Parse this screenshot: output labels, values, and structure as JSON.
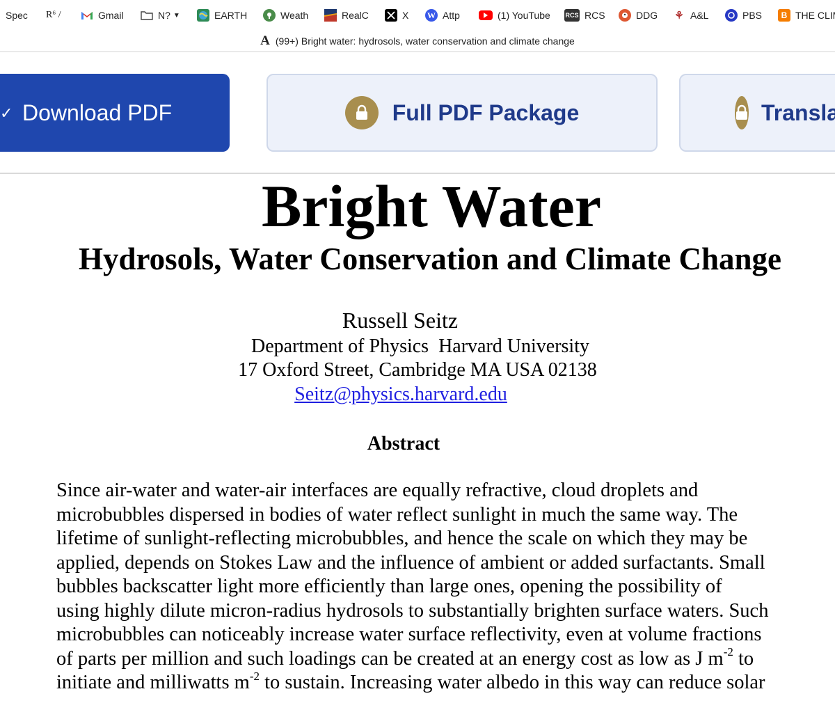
{
  "bookmarks": [
    {
      "label": "Spec",
      "icon": "none"
    },
    {
      "label": "R⁶ /",
      "icon": "none"
    },
    {
      "label": "Gmail",
      "icon": "gmail-icon"
    },
    {
      "label": "N?",
      "icon": "folder-icon"
    },
    {
      "label": "EARTH",
      "icon": "earth-icon"
    },
    {
      "label": "Weath",
      "icon": "weather-icon"
    },
    {
      "label": "RealC",
      "icon": "realclimate-icon"
    },
    {
      "label": "X",
      "icon": "x-icon"
    },
    {
      "label": "Attp",
      "icon": "wordpress-icon"
    },
    {
      "label": "(1) YouTube",
      "icon": "youtube-icon"
    },
    {
      "label": "RCS",
      "icon": "rcs-icon"
    },
    {
      "label": "DDG",
      "icon": "duckduckgo-icon"
    },
    {
      "label": "A&L",
      "icon": "al-icon"
    },
    {
      "label": "PBS",
      "icon": "pbs-icon"
    },
    {
      "label": "THE CLIMATE",
      "icon": "blogger-icon"
    }
  ],
  "tab_title": "(99+) Bright water: hydrosols, water conservation and climate change",
  "buttons": {
    "download": "Download PDF",
    "full_package": "Full PDF Package",
    "translate": "Translate"
  },
  "paper": {
    "title": "Bright Water",
    "subtitle": "Hydrosols, Water Conservation and Climate Change",
    "author": "Russell Seitz",
    "affiliation": "Department of Physics  Harvard University",
    "address": "17 Oxford Street, Cambridge MA USA 02138",
    "email": "Seitz@physics.harvard.edu",
    "abstract_heading": "Abstract",
    "abstract_lines": [
      "Since air-water and water-air interfaces are equally refractive, cloud droplets and",
      "microbubbles dispersed in bodies of water reflect sunlight in much the same way. The",
      "lifetime of sunlight-reflecting microbubbles, and hence the scale on which they may be",
      "applied, depends on Stokes Law and the influence of ambient or added surfactants. Small",
      "bubbles backscatter light more efficiently than large ones, opening the possibility of",
      "using highly dilute micron-radius hydrosols to substantially brighten surface waters. Such",
      "microbubbles can noticeably increase water surface reflectivity, even at volume fractions"
    ],
    "abstract_line8": {
      "before": "of parts per million and such loadings can be created at an energy cost as low as J m",
      "sup": "-2",
      "after": " to"
    },
    "abstract_line9": {
      "before": "initiate and milliwatts m",
      "sup": "-2",
      "after": " to sustain. Increasing water albedo in this way can reduce solar"
    }
  }
}
